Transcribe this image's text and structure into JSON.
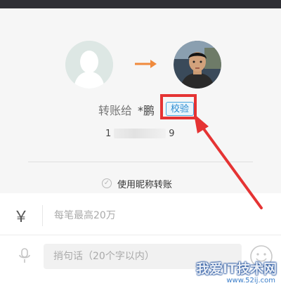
{
  "transfer": {
    "title": "转账给",
    "recipient_name": "*鹏",
    "verify_label": "校验",
    "account_prefix": "1",
    "account_suffix": "9"
  },
  "options": {
    "nickname_label": "使用昵称转账"
  },
  "amount": {
    "currency_symbol": "￥",
    "placeholder": "每笔最高20万"
  },
  "message": {
    "placeholder": "捎句话（20个字以内）"
  },
  "watermark": {
    "main": "我爱IT技术网",
    "sub": "www.52ij.com"
  },
  "colors": {
    "highlight": "#e53333",
    "verify_accent": "#2b8bd0",
    "arrow_orange": "#f08a3c"
  },
  "icons": [
    "avatar-placeholder-icon",
    "right-arrow-icon",
    "check-circle-icon",
    "microphone-icon",
    "emoji-icon"
  ]
}
